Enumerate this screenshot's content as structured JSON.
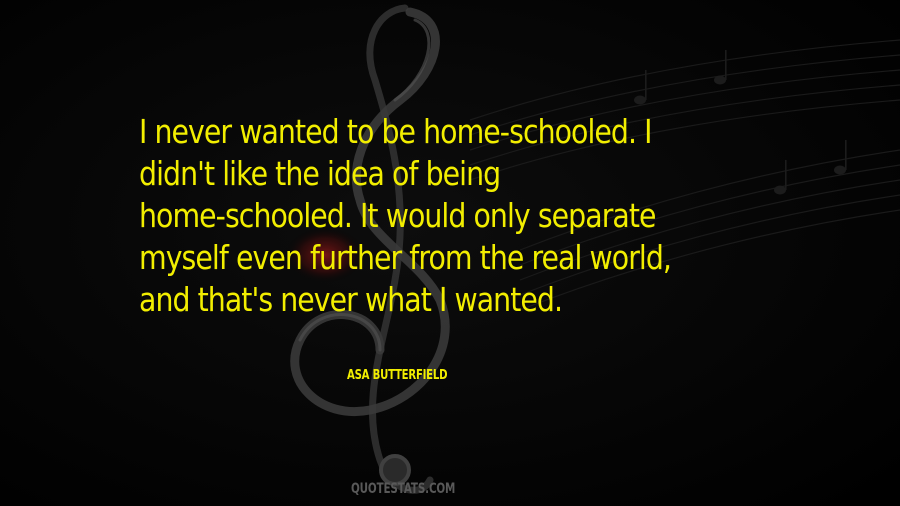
{
  "quote": {
    "lines": [
      "I never wanted to be home-schooled. I",
      "didn't like the idea of being",
      "home-schooled. It would only separate",
      "myself even further from the real world,",
      "and that's never what I wanted."
    ],
    "color": "#f2ee00"
  },
  "author": "Asa Butterfield",
  "watermark": "QUOTESTATS.COM",
  "background": {
    "color": "#050505",
    "art": "treble-clef-with-music-staff",
    "accent_color": "#7a1414"
  }
}
